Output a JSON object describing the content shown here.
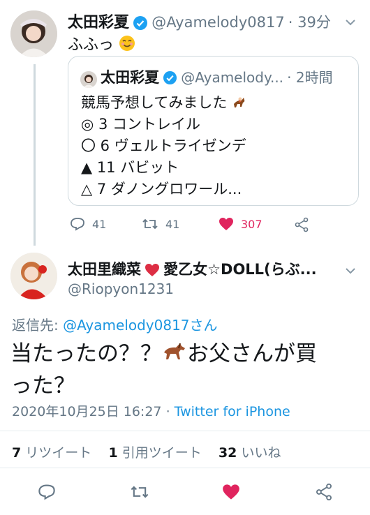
{
  "tweet1": {
    "name": "太田彩夏",
    "handle": "@Ayamelody0817",
    "time": "· 39分",
    "text": "ふふっ",
    "emoji_icon": "smiling-face-emoji"
  },
  "quoted": {
    "name": "太田彩夏",
    "handle": "@Ayamelody...",
    "time": "· 2時間",
    "lines": [
      "競馬予想してみました",
      "◎ 3 コントレイル",
      "〇 6 ヴェルトライゼンデ",
      "▲ 11 バビット",
      "△ 7 ダノングロワール..."
    ],
    "horse_icon": "horse-racing-emoji"
  },
  "tweet1_actions": {
    "reply_count": "41",
    "retweet_count": "41",
    "like_count": "307",
    "like_color": "#e0245e"
  },
  "reply": {
    "name_part1": "太田里織菜",
    "name_part2": "愛乙女☆DOLL(らぶ...",
    "handle": "@Riopyon1231",
    "replying_to_label": "返信先:",
    "replying_to_user": "@Ayamelody0817さん",
    "text_line1": "当たったの？？",
    "text_line1b": "お父さんが買",
    "text_line2": "った？",
    "timestamp": "2020年10月25日 16:27",
    "separator": "·",
    "source": "Twitter for iPhone"
  },
  "stats": {
    "retweets_num": "7",
    "retweets_label": "リツイート",
    "quotes_num": "1",
    "quotes_label": "引用ツイート",
    "likes_num": "32",
    "likes_label": "いいね"
  },
  "colors": {
    "link": "#1b95e0",
    "verified": "#1da1f2",
    "heart": "#e0245e"
  }
}
